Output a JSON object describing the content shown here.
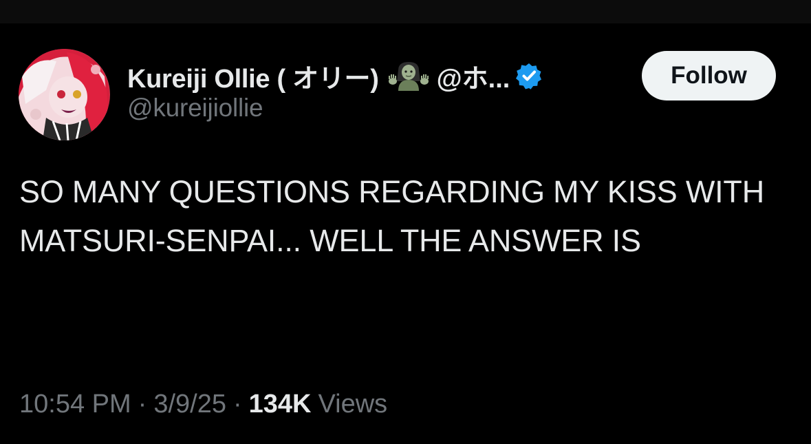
{
  "tweet": {
    "author": {
      "display_name": "Kureiji Ollie ( オリー)",
      "handle_truncated": "@ホ...",
      "username": "@kureijiollie",
      "verified": true,
      "avatar_icon": "avatar-image",
      "emoji_icon": "zombie-woman-icon"
    },
    "follow_label": "Follow",
    "text": "SO MANY QUESTIONS REGARDING MY KISS WITH MATSURI-SENPAI... WELL THE ANSWER IS",
    "time": "10:54 PM",
    "separator": "·",
    "date": "3/9/25",
    "views_count": "134K",
    "views_label": "Views"
  },
  "colors": {
    "background": "#000000",
    "primary_text": "#e7e9ea",
    "secondary_text": "#71767b",
    "follow_bg": "#eff3f4",
    "verified_blue": "#1d9bf0",
    "avatar_accent": "#c01a35"
  }
}
